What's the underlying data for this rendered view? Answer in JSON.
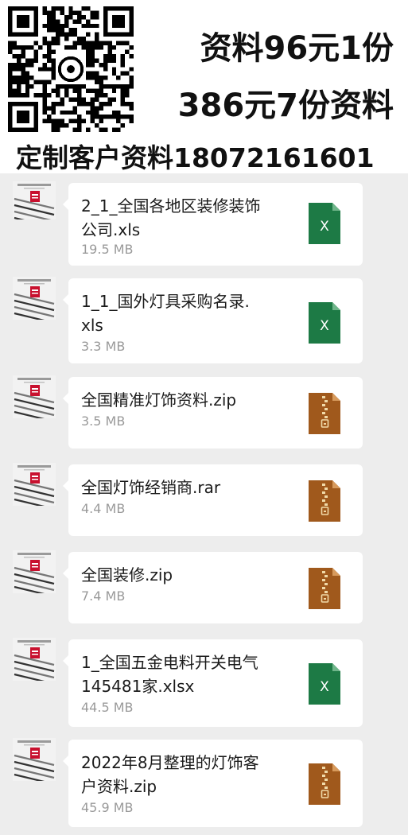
{
  "banner": {
    "promo_line_1": "资料96元1份",
    "promo_line_2": "386元7份资料",
    "contact_line": "定制客户资料18072161601"
  },
  "messages": [
    {
      "name_line_1": "2_1_全国各地区装修装饰",
      "name_line_2": "公司.xls",
      "size": "19.5 MB",
      "icon": "excel-icon"
    },
    {
      "name_line_1": "1_1_国外灯具采购名录.",
      "name_line_2": "xls",
      "size": "3.3 MB",
      "icon": "excel-icon"
    },
    {
      "name_line_1": "全国精准灯饰资料.zip",
      "name_line_2": "",
      "size": "3.5 MB",
      "icon": "zip-icon"
    },
    {
      "name_line_1": "全国灯饰经销商.rar",
      "name_line_2": "",
      "size": "4.4 MB",
      "icon": "zip-icon"
    },
    {
      "name_line_1": "全国装修.zip",
      "name_line_2": "",
      "size": "7.4 MB",
      "icon": "zip-icon"
    },
    {
      "name_line_1": "1_全国五金电料开关电气",
      "name_line_2": "145481家.xlsx",
      "size": "44.5 MB",
      "icon": "excel-icon"
    },
    {
      "name_line_1": "2022年8月整理的灯饰客",
      "name_line_2": "户资料.zip",
      "size": "45.9 MB",
      "icon": "zip-icon"
    }
  ],
  "excel_icon_letter": "X",
  "colors": {
    "excel": "#1d7a45",
    "zip": "#a0591c",
    "zip_zipper": "#f0d9a8",
    "background": "#ededed"
  }
}
